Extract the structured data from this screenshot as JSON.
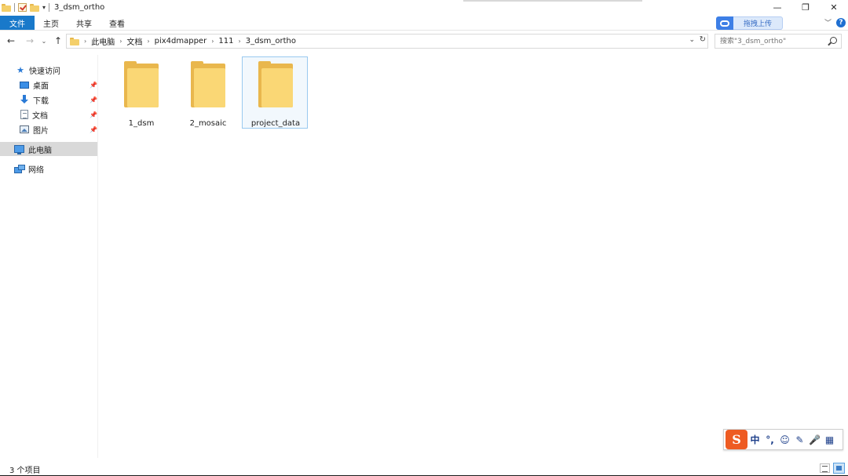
{
  "window": {
    "title": "3_dsm_ortho",
    "minimize": "—",
    "restore": "❐",
    "close": "✕"
  },
  "ribbon": {
    "tabs": [
      {
        "label": "文件"
      },
      {
        "label": "主页"
      },
      {
        "label": "共享"
      },
      {
        "label": "查看"
      }
    ],
    "cloud_upload_label": "拖拽上传",
    "help": "?"
  },
  "address": {
    "crumbs": [
      "此电脑",
      "文档",
      "pix4dmapper",
      "111",
      "3_dsm_ortho"
    ]
  },
  "search": {
    "placeholder": "搜索\"3_dsm_ortho\""
  },
  "navpane": {
    "quick_access": "快速访问",
    "items": [
      {
        "label": "桌面",
        "icon": "desktop-icon"
      },
      {
        "label": "下载",
        "icon": "download-icon"
      },
      {
        "label": "文档",
        "icon": "document-icon"
      },
      {
        "label": "图片",
        "icon": "picture-icon"
      }
    ],
    "this_pc": "此电脑",
    "network": "网络"
  },
  "files": [
    {
      "name": "1_dsm"
    },
    {
      "name": "2_mosaic"
    },
    {
      "name": "project_data",
      "selected": true
    }
  ],
  "ime": {
    "logo": "S",
    "items": [
      "中",
      "°,",
      "☺",
      "✎",
      "🎤",
      "▦"
    ]
  },
  "status": {
    "count_text": "3 个项目"
  }
}
